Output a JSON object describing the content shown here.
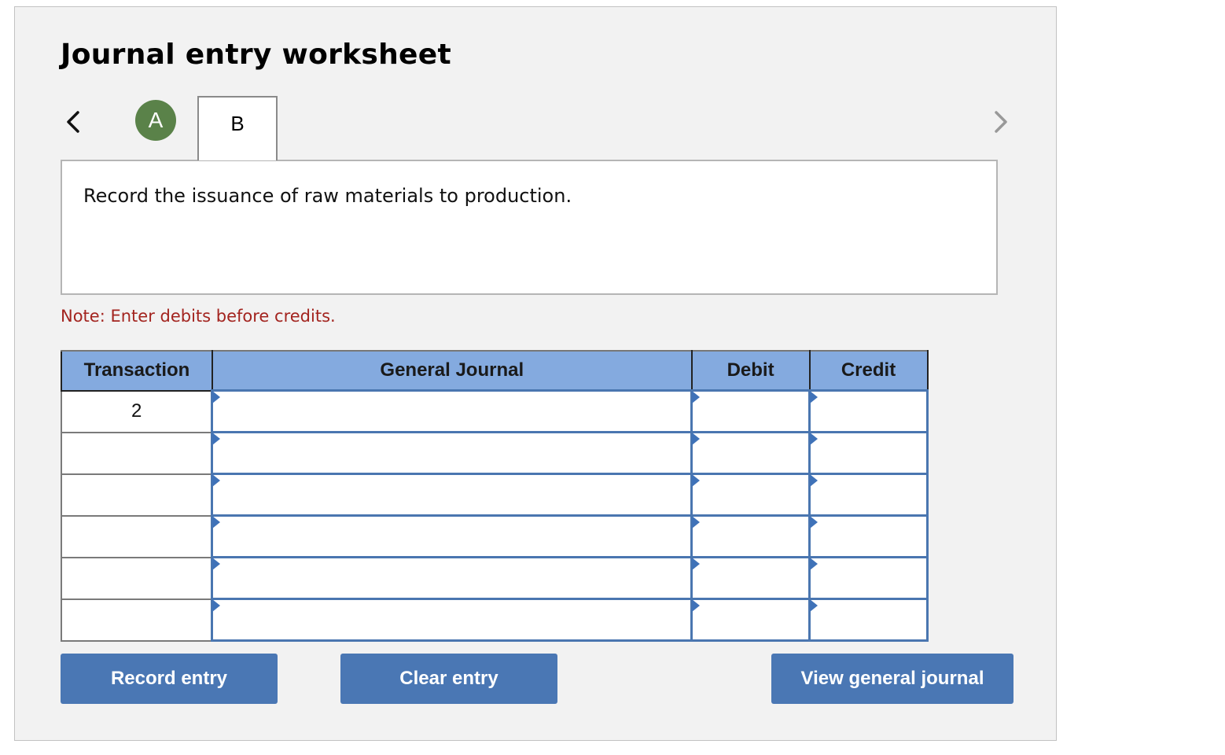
{
  "worksheet": {
    "title": "Journal entry worksheet",
    "tabs": [
      {
        "label": "A",
        "state": "completed",
        "color": "#5a8249"
      },
      {
        "label": "B",
        "state": "active"
      }
    ],
    "question": "Record the issuance of raw materials to production.",
    "note": "Note: Enter debits before credits.",
    "note_color": "#a3241f"
  },
  "table": {
    "headers": [
      "Transaction",
      "General Journal",
      "Debit",
      "Credit"
    ],
    "header_color": "#84aadf",
    "rows": [
      {
        "transaction": "2",
        "account": "",
        "debit": "",
        "credit": ""
      },
      {
        "transaction": "",
        "account": "",
        "debit": "",
        "credit": ""
      },
      {
        "transaction": "",
        "account": "",
        "debit": "",
        "credit": ""
      },
      {
        "transaction": "",
        "account": "",
        "debit": "",
        "credit": ""
      },
      {
        "transaction": "",
        "account": "",
        "debit": "",
        "credit": ""
      },
      {
        "transaction": "",
        "account": "",
        "debit": "",
        "credit": ""
      }
    ]
  },
  "buttons": {
    "record": "Record entry",
    "clear": "Clear entry",
    "view": "View general journal",
    "color": "#4a77b4"
  },
  "icons": {
    "prev": "chevron-left-icon",
    "next": "chevron-right-icon"
  }
}
